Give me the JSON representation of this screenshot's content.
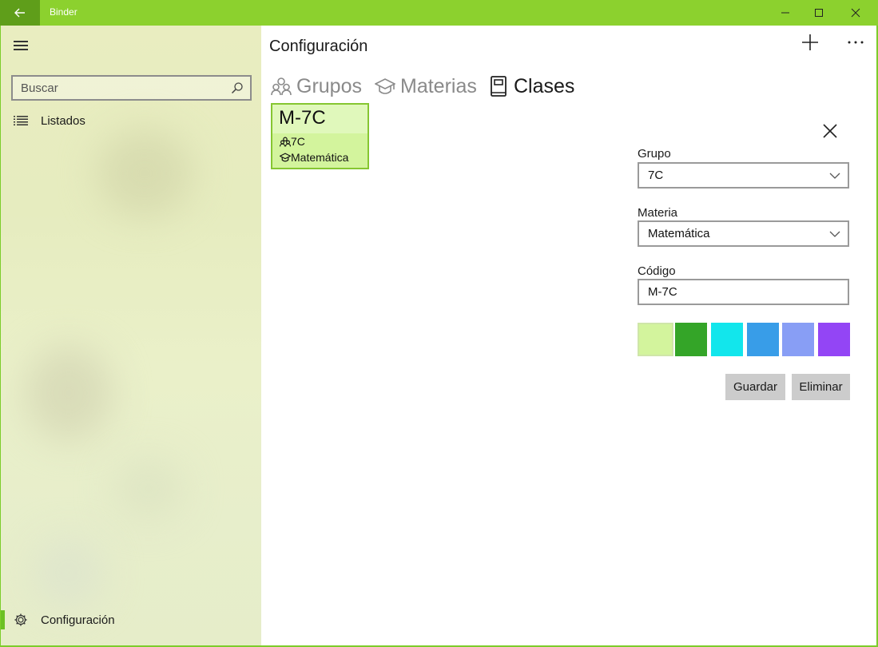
{
  "window": {
    "title": "Binder",
    "accent": "#8cd12e",
    "back_bg": "#5f9e1a"
  },
  "sidebar": {
    "search_placeholder": "Buscar",
    "items": [
      {
        "label": "Listados",
        "icon": "list-icon"
      },
      {
        "label": "Configuración",
        "icon": "gear-icon",
        "active": true
      }
    ]
  },
  "main": {
    "title": "Configuración",
    "tabs": [
      {
        "label": "Grupos",
        "icon": "people-icon",
        "active": false
      },
      {
        "label": "Materias",
        "icon": "graduation-cap-icon",
        "active": false
      },
      {
        "label": "Clases",
        "icon": "book-icon",
        "active": true
      }
    ],
    "cards": [
      {
        "code": "M-7C",
        "group": "7C",
        "subject": "Matemática",
        "color": "#d3f49d"
      }
    ]
  },
  "form": {
    "group_label": "Grupo",
    "group_value": "7C",
    "subject_label": "Materia",
    "subject_value": "Matemática",
    "code_label": "Código",
    "code_value": "M-7C",
    "colors": [
      "#d3f49d",
      "#34a528",
      "#12e6ec",
      "#389de8",
      "#889ef5",
      "#9345f5"
    ],
    "selected_color": "#d3f49d",
    "save_label": "Guardar",
    "delete_label": "Eliminar"
  }
}
